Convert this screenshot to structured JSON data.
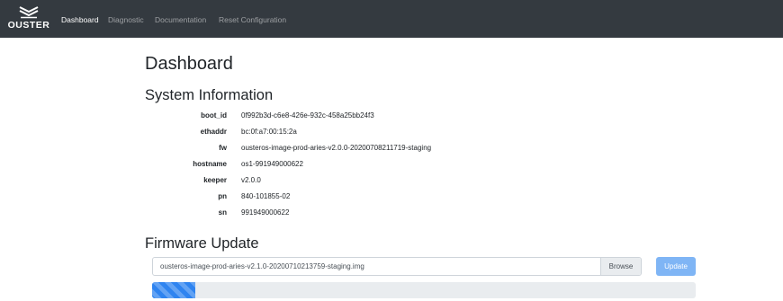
{
  "navbar": {
    "brand": "OUSTER",
    "links": [
      "Dashboard",
      "Diagnostic",
      "Documentation",
      "Reset Configuration"
    ],
    "active": "Dashboard",
    "background": "#343a40"
  },
  "page": {
    "title": "Dashboard"
  },
  "system_info": {
    "title": "System Information",
    "rows": [
      {
        "key": "boot_id",
        "value": "0f992b3d-c6e8-426e-932c-458a25bb24f3"
      },
      {
        "key": "ethaddr",
        "value": "bc:0f:a7:00:15:2a"
      },
      {
        "key": "fw",
        "value": "ousteros-image-prod-aries-v2.0.0-20200708211719-staging"
      },
      {
        "key": "hostname",
        "value": "os1-991949000622"
      },
      {
        "key": "keeper",
        "value": "v2.0.0"
      },
      {
        "key": "pn",
        "value": "840-101855-02"
      },
      {
        "key": "sn",
        "value": "991949000622"
      }
    ]
  },
  "firmware_update": {
    "title": "Firmware Update",
    "file_value": "ousteros-image-prod-aries-v2.1.0-20200710213759-staging.img",
    "browse_label": "Browse",
    "update_label": "Update",
    "update_color": "#7fb5f5",
    "progress_percent": 8,
    "progress_color": "#2f84f0"
  }
}
